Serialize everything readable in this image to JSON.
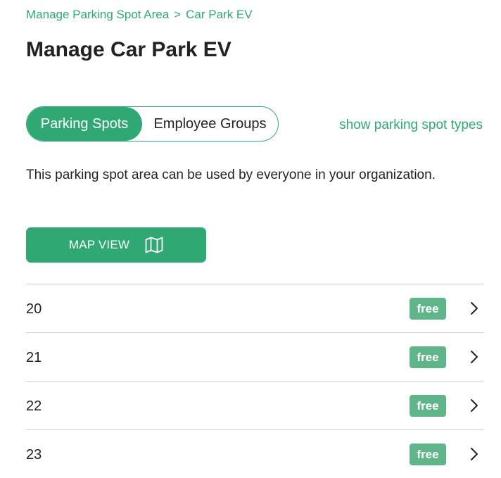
{
  "breadcrumb": {
    "parent": "Manage Parking Spot Area",
    "separator": ">",
    "current": "Car Park EV"
  },
  "page_title": "Manage Car Park EV",
  "tabs": {
    "parking_spots": "Parking Spots",
    "employee_groups": "Employee Groups",
    "active": "parking_spots"
  },
  "show_types_link": "show parking spot types",
  "info_text": "This parking spot area can be used by everyone in your organization.",
  "map_view_button": {
    "label": "MAP VIEW",
    "icon": "map-icon"
  },
  "spots": [
    {
      "number": "20",
      "status": "free"
    },
    {
      "number": "21",
      "status": "free"
    },
    {
      "number": "22",
      "status": "free"
    },
    {
      "number": "23",
      "status": "free"
    }
  ],
  "colors": {
    "accent": "#2fa874",
    "badge": "#5fb48a",
    "text": "#222222",
    "divider": "#cfcfcf"
  }
}
